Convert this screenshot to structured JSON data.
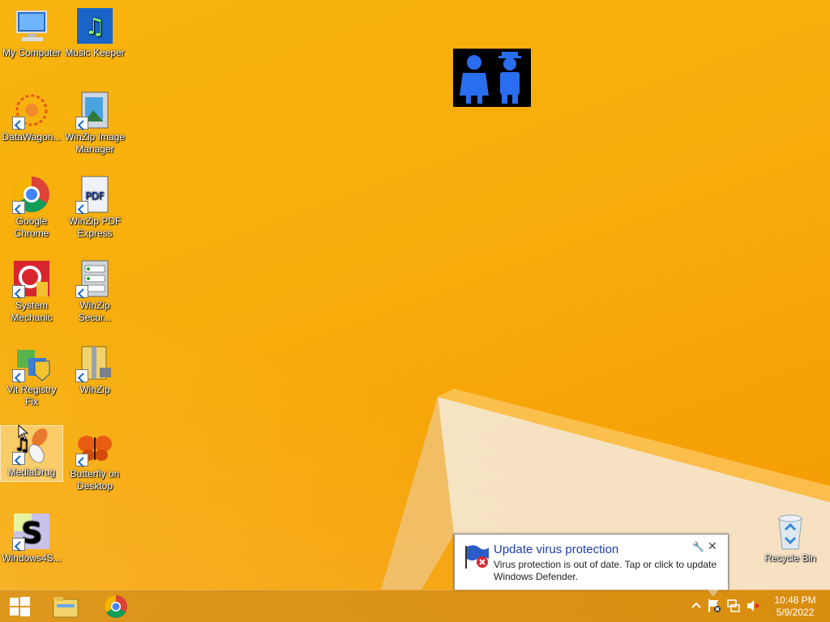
{
  "desktop": {
    "icons": [
      {
        "label": "My Computer"
      },
      {
        "label": "Music Keeper"
      },
      {
        "label": "DataWagon..."
      },
      {
        "label": "WinZip Image Manager"
      },
      {
        "label": "Google Chrome"
      },
      {
        "label": "WinZip PDF Express"
      },
      {
        "label": "System Mechanic"
      },
      {
        "label": "WinZip Secur..."
      },
      {
        "label": "Vit Registry Fix"
      },
      {
        "label": "WinZip"
      },
      {
        "label": "MediaDrug"
      },
      {
        "label": "Butterfly on Desktop"
      },
      {
        "label": "Windows4S..."
      },
      {
        "label": "Recycle Bin"
      }
    ]
  },
  "notification": {
    "title": "Update virus protection",
    "body": "Virus protection is out of date. Tap or click to update Windows Defender.",
    "close_label": "✕"
  },
  "taskbar": {
    "time": "10:48 PM",
    "date": "5/9/2022"
  },
  "colors": {
    "wallpaper": "#f7ad0b",
    "notification_title": "#1c3fa8"
  }
}
